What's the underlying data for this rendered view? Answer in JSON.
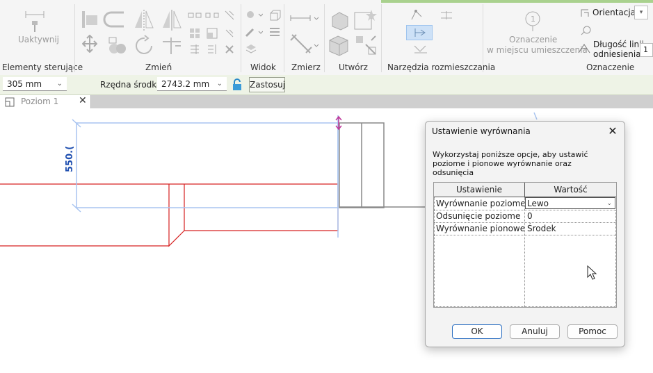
{
  "ribbon": {
    "groups": [
      {
        "label": "Elementy sterujące"
      },
      {
        "label": "Zmień"
      },
      {
        "label": "Widok"
      },
      {
        "label": "Zmierz"
      },
      {
        "label": "Utwórz"
      },
      {
        "label": "Narzędzia rozmieszczania"
      },
      {
        "label": "Oznaczenie"
      }
    ],
    "activate_label": "Uaktywnij",
    "tag_placed_line1": "Oznaczenie",
    "tag_placed_line2": "w miejscu umieszczenia",
    "orientation_label": "Orientacja",
    "leader_length_line1": "Długość linii",
    "leader_length_line2": "odniesienia",
    "leader_length_value": "1"
  },
  "options_bar": {
    "offset_value": "305 mm",
    "center_elevation_label": "Rzędna środka:",
    "center_elevation_value": "2743.2 mm",
    "apply_label": "Zastosuj"
  },
  "view_tab": {
    "label": "Poziom 1",
    "close": "✕"
  },
  "canvas": {
    "dimension_text": "550.("
  },
  "dialog": {
    "title": "Ustawienie wyrównania",
    "close": "✕",
    "description": "Wykorzystaj poniższe opcje, aby ustawić poziome i pionowe wyrównanie oraz odsunięcia",
    "grid": {
      "headers": [
        "Ustawienie",
        "Wartość"
      ],
      "rows": [
        {
          "setting": "Wyrównanie poziome",
          "value": "Lewo"
        },
        {
          "setting": "Odsunięcie poziome",
          "value": "0"
        },
        {
          "setting": "Wyrównanie pionowe",
          "value": "Środek"
        }
      ]
    },
    "buttons": {
      "ok": "OK",
      "cancel": "Anuluj",
      "help": "Pomoc"
    }
  },
  "colors": {
    "accent_green": "#a9d18e",
    "options_bar_bg": "#eef3e6",
    "selection_blue": "#a8c4f0",
    "element_red": "#d62020",
    "dimension_blue": "#1f4fb0"
  }
}
